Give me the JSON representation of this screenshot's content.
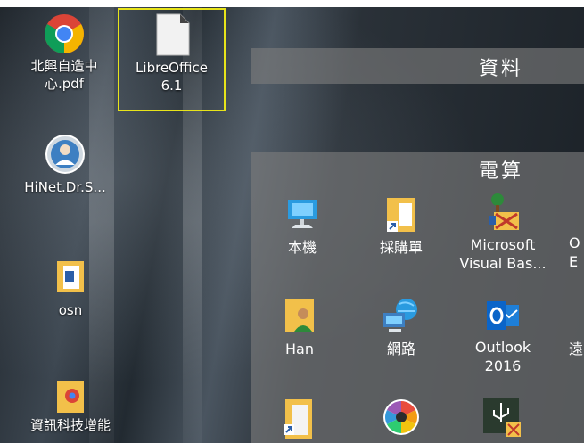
{
  "desktop_icons": [
    {
      "id": "chrome_pdf",
      "line1": "北興自造中",
      "line2": "心.pdf"
    },
    {
      "id": "libreoffice",
      "line1": "LibreOffice",
      "line2": "6.1"
    },
    {
      "id": "hinet",
      "line1": "HiNet.Dr.S..."
    },
    {
      "id": "osn",
      "line1": "osn"
    },
    {
      "id": "info_tech",
      "line1": "資訊科技增能"
    }
  ],
  "start_groups": [
    {
      "id": "data",
      "title": "資料"
    },
    {
      "id": "computer",
      "title": "電算"
    }
  ],
  "tiles": {
    "this_pc": {
      "line1": "本機"
    },
    "purchase": {
      "line1": "採購單"
    },
    "vba": {
      "line1": "Microsoft",
      "line2": "Visual Bas..."
    },
    "partial_o": {
      "line1": "O",
      "line2": "E"
    },
    "han": {
      "line1": "Han"
    },
    "network": {
      "line1": "網路"
    },
    "outlook": {
      "line1": "Outlook",
      "line2": "2016"
    },
    "partial_yuan": {
      "line1": "遠"
    }
  },
  "colors": {
    "selection_border": "#e8e41a",
    "outlook_blue": "#0a64c8",
    "folder_yellow": "#f2c04a"
  }
}
